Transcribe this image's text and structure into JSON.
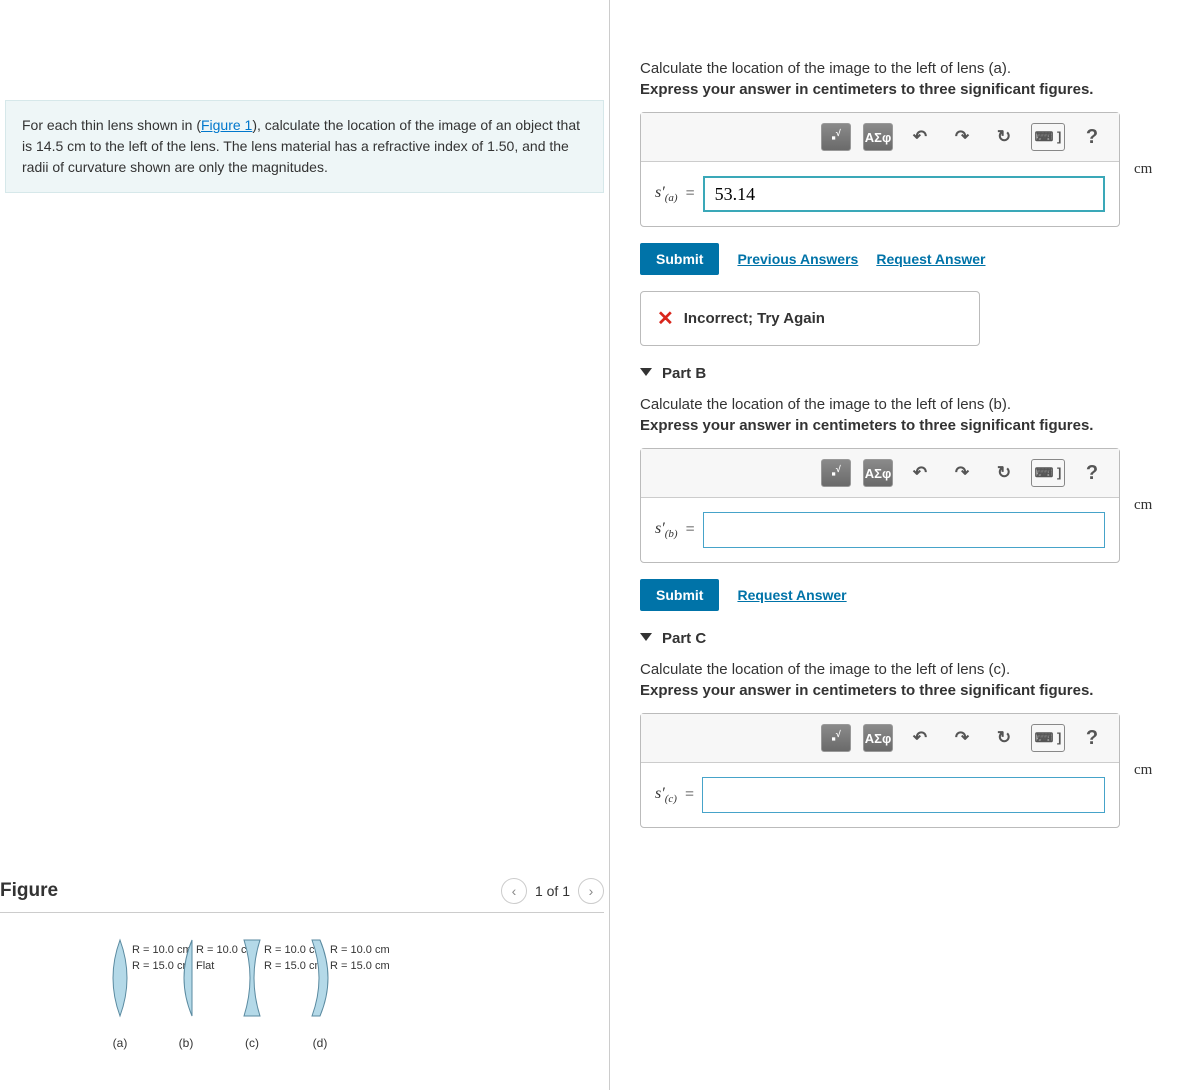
{
  "intro": {
    "prefix": "For each thin lens shown in (",
    "figure_link": "Figure 1",
    "suffix": "), calculate the location of the image of an object that is 14.5 cm to the left of the lens. The lens material has a refractive index of 1.50, and the radii of curvature shown are only the magnitudes."
  },
  "figure": {
    "title": "Figure",
    "pager": "1 of 1",
    "lenses": [
      {
        "label": "(a)",
        "r1": "R = 10.0 cm",
        "r2": "R = 15.0 cm"
      },
      {
        "label": "(b)",
        "r1": "R = 10.0 cm",
        "r2": "Flat"
      },
      {
        "label": "(c)",
        "r1": "R = 10.0 cm",
        "r2": "R = 15.0 cm"
      },
      {
        "label": "(d)",
        "r1": "R = 10.0 cm",
        "r2": "R = 15.0 cm"
      }
    ]
  },
  "toolbar": {
    "sqrt": "√",
    "greek": "ΑΣφ",
    "undo": "↶",
    "redo": "↷",
    "reset": "↻",
    "keyboard": "⌨ ]",
    "help": "?"
  },
  "partA": {
    "prompt": "Calculate the location of the image to the left of lens (a).",
    "sub": "Express your answer in centimeters to three significant figures.",
    "var": "s′",
    "sub_var": "(a)",
    "value": "53.14",
    "unit": "cm",
    "submit": "Submit",
    "prev": "Previous Answers",
    "req": "Request Answer",
    "feedback": "Incorrect; Try Again"
  },
  "partB": {
    "title": "Part B",
    "prompt": "Calculate the location of the image to the left of lens (b).",
    "sub": "Express your answer in centimeters to three significant figures.",
    "var": "s′",
    "sub_var": "(b)",
    "value": "",
    "unit": "cm",
    "submit": "Submit",
    "req": "Request Answer"
  },
  "partC": {
    "title": "Part C",
    "prompt": "Calculate the location of the image to the left of lens (c).",
    "sub": "Express your answer in centimeters to three significant figures.",
    "var": "s′",
    "sub_var": "(c)",
    "value": "",
    "unit": "cm"
  }
}
